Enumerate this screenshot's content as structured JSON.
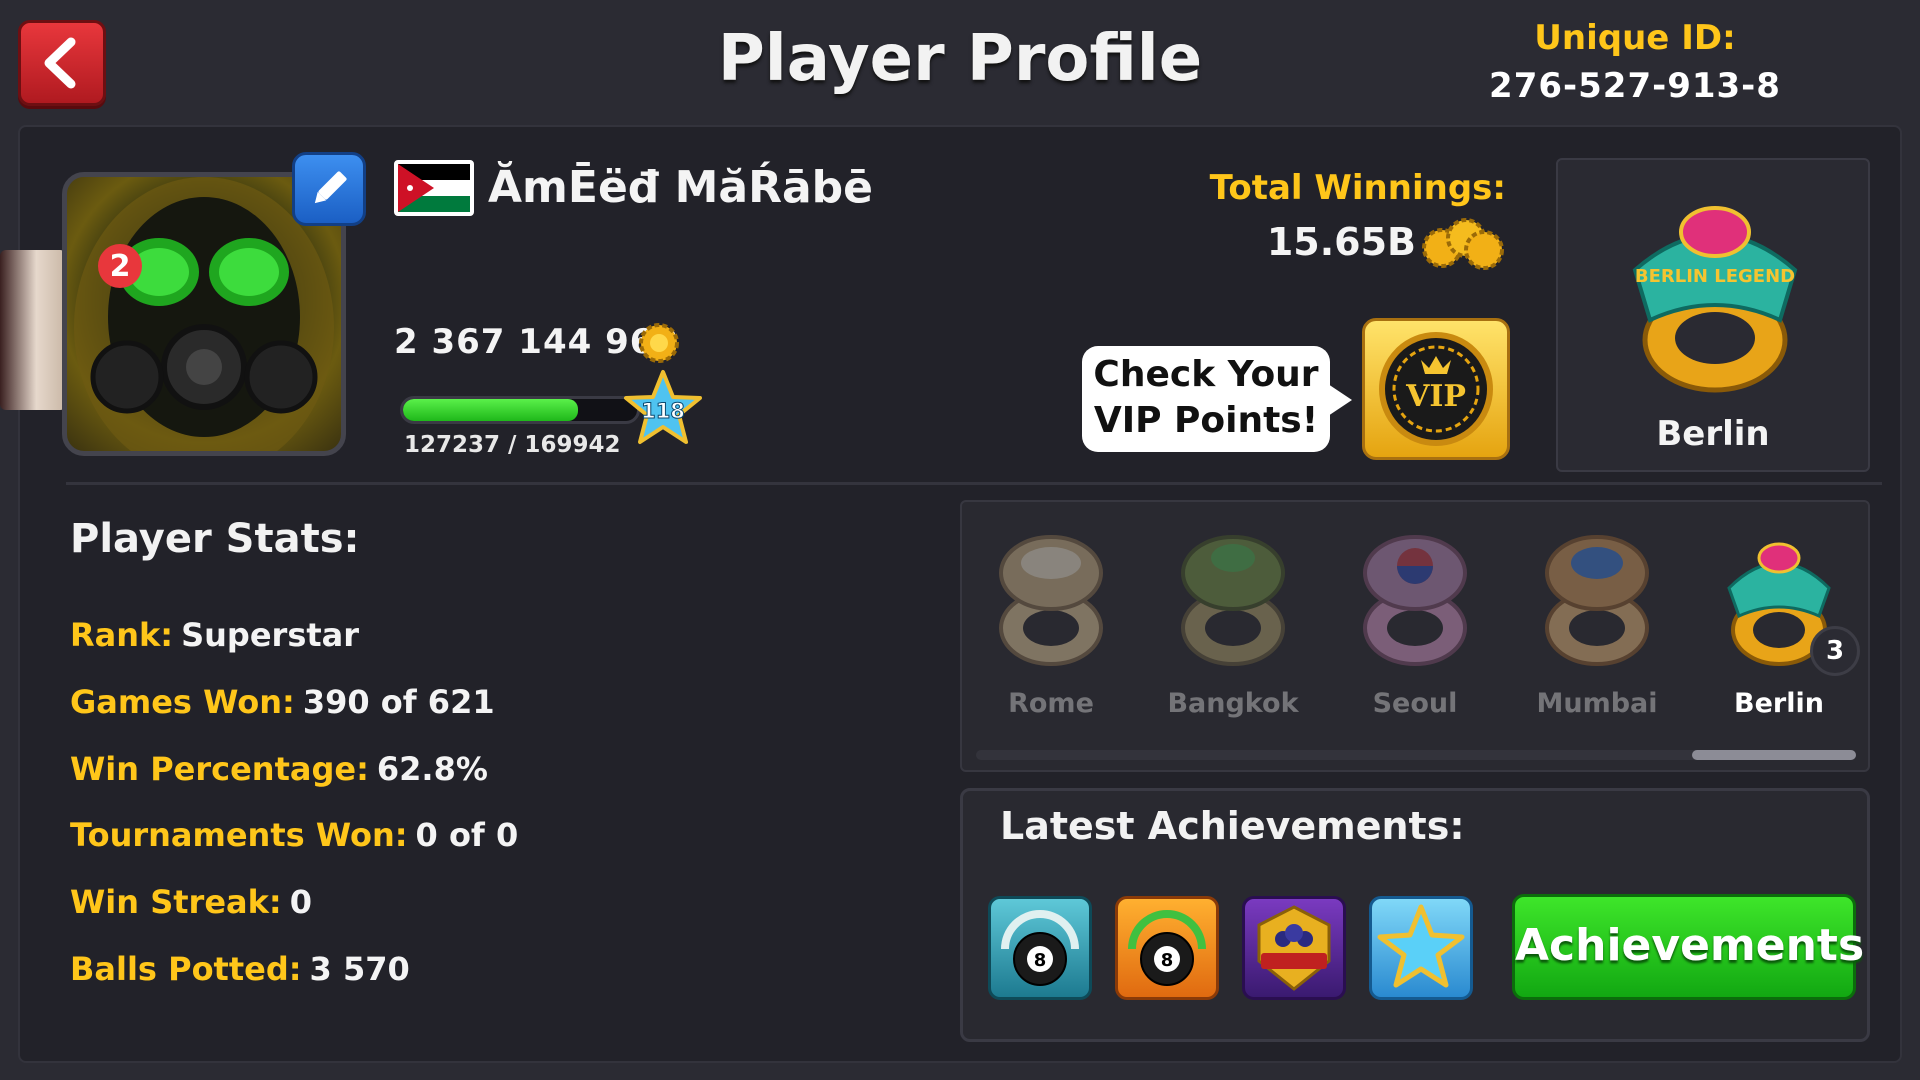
{
  "header": {
    "title": "Player Profile",
    "unique_id_label": "Unique ID:",
    "unique_id_value": "276-527-913-8"
  },
  "profile": {
    "name": "ĂmĒëđ MăŔābē",
    "flag": "jordan-flag",
    "friend_badge_count": "2",
    "coins": "2 367 144 960",
    "level": "118",
    "xp_text": "127237 / 169942",
    "xp_fraction": 0.749
  },
  "winnings": {
    "label": "Total Winnings:",
    "value": "15.65B"
  },
  "vip": {
    "bubble_line1": "Check Your",
    "bubble_line2": "VIP Points!",
    "button_label": "VIP"
  },
  "featured_ring": {
    "name": "Berlin",
    "ring_text": "BERLIN LEGEND"
  },
  "stats": {
    "title": "Player Stats:",
    "rows": [
      {
        "label": "Rank:",
        "value": "Superstar"
      },
      {
        "label": "Games Won:",
        "value": "390 of 621"
      },
      {
        "label": "Win Percentage:",
        "value": "62.8%"
      },
      {
        "label": "Tournaments Won:",
        "value": "0 of 0"
      },
      {
        "label": "Win Streak:",
        "value": "0"
      },
      {
        "label": "Balls Potted:",
        "value": "3 570"
      }
    ]
  },
  "rings": [
    {
      "name": "Rome",
      "owned": false,
      "color": "#e8cfa0"
    },
    {
      "name": "Bangkok",
      "owned": false,
      "color": "#9bb06a"
    },
    {
      "name": "Seoul",
      "owned": false,
      "color": "#c8a0c8"
    },
    {
      "name": "Mumbai",
      "owned": false,
      "color": "#d8b880"
    },
    {
      "name": "Berlin",
      "owned": true,
      "count": "3",
      "color": "#f0b020"
    }
  ],
  "achievements": {
    "title": "Latest Achievements:",
    "button_label": "Achievements",
    "icons": [
      "8-ball-speed-teal-icon",
      "8-ball-speed-orange-icon",
      "club-50-badge-icon",
      "blue-star-icon"
    ]
  },
  "colors": {
    "accent_gold": "#ffc61a",
    "background": "#2b2b33",
    "green_button": "#22c21a",
    "back_button": "#d42a30"
  }
}
